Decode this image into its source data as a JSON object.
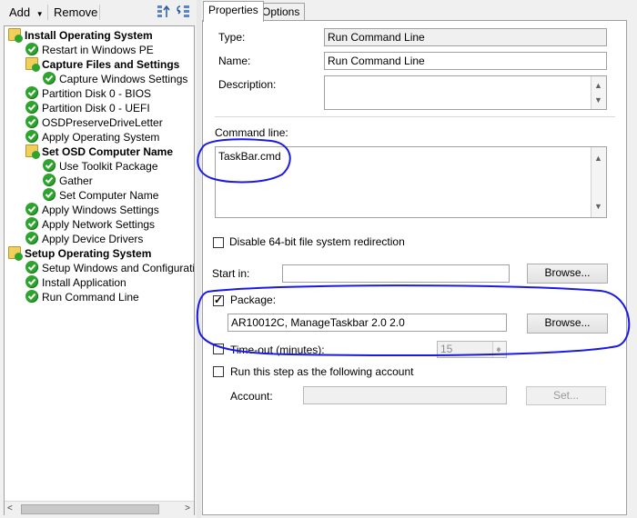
{
  "toolbar": {
    "add_label": "Add",
    "remove_label": "Remove"
  },
  "tree": {
    "items": [
      {
        "label": "Install Operating System",
        "icon": "folder-check-icon"
      },
      {
        "label": "Restart in Windows PE",
        "icon": "check-icon"
      },
      {
        "label": "Capture Files and Settings",
        "icon": "folder-check-icon"
      },
      {
        "label": "Capture Windows Settings",
        "icon": "check-icon"
      },
      {
        "label": "Partition Disk 0 - BIOS",
        "icon": "check-icon"
      },
      {
        "label": "Partition Disk 0 - UEFI",
        "icon": "check-icon"
      },
      {
        "label": "OSDPreserveDriveLetter",
        "icon": "check-icon"
      },
      {
        "label": "Apply Operating System",
        "icon": "check-icon"
      },
      {
        "label": "Set OSD Computer Name",
        "icon": "folder-check-icon"
      },
      {
        "label": "Use Toolkit Package",
        "icon": "check-icon"
      },
      {
        "label": "Gather",
        "icon": "check-icon"
      },
      {
        "label": "Set Computer Name",
        "icon": "check-icon"
      },
      {
        "label": "Apply Windows Settings",
        "icon": "check-icon"
      },
      {
        "label": "Apply Network Settings",
        "icon": "check-icon"
      },
      {
        "label": "Apply Device Drivers",
        "icon": "check-icon"
      },
      {
        "label": "Setup Operating System",
        "icon": "folder-check-icon"
      },
      {
        "label": "Setup Windows and Configuration",
        "icon": "check-icon"
      },
      {
        "label": "Install Application",
        "icon": "check-icon"
      },
      {
        "label": "Run Command Line",
        "icon": "check-icon"
      }
    ]
  },
  "tabs": [
    {
      "label": "Properties"
    },
    {
      "label": "Options"
    }
  ],
  "properties": {
    "type_label": "Type:",
    "type_value": "Run Command Line",
    "name_label": "Name:",
    "name_value": "Run Command Line",
    "description_label": "Description:",
    "description_value": "",
    "command_line_label": "Command line:",
    "command_line_value": "TaskBar.cmd",
    "disable64_label": "Disable 64-bit file system redirection",
    "disable64_checked": false,
    "start_in_label": "Start in:",
    "start_in_value": "",
    "browse_label": "Browse...",
    "package_label": "Package:",
    "package_checked": true,
    "package_value": "AR10012C, ManageTaskbar 2.0 2.0",
    "timeout_label": "Time-out (minutes):",
    "timeout_checked": false,
    "timeout_value": "15",
    "run_as_label": "Run this step as the following account",
    "run_as_checked": false,
    "account_label": "Account:",
    "account_value": "",
    "set_label": "Set..."
  },
  "colors": {
    "check_green": "#2da52d",
    "folder_yellow": "#f2cf5b",
    "annotation_blue": "#1a1ae6"
  }
}
